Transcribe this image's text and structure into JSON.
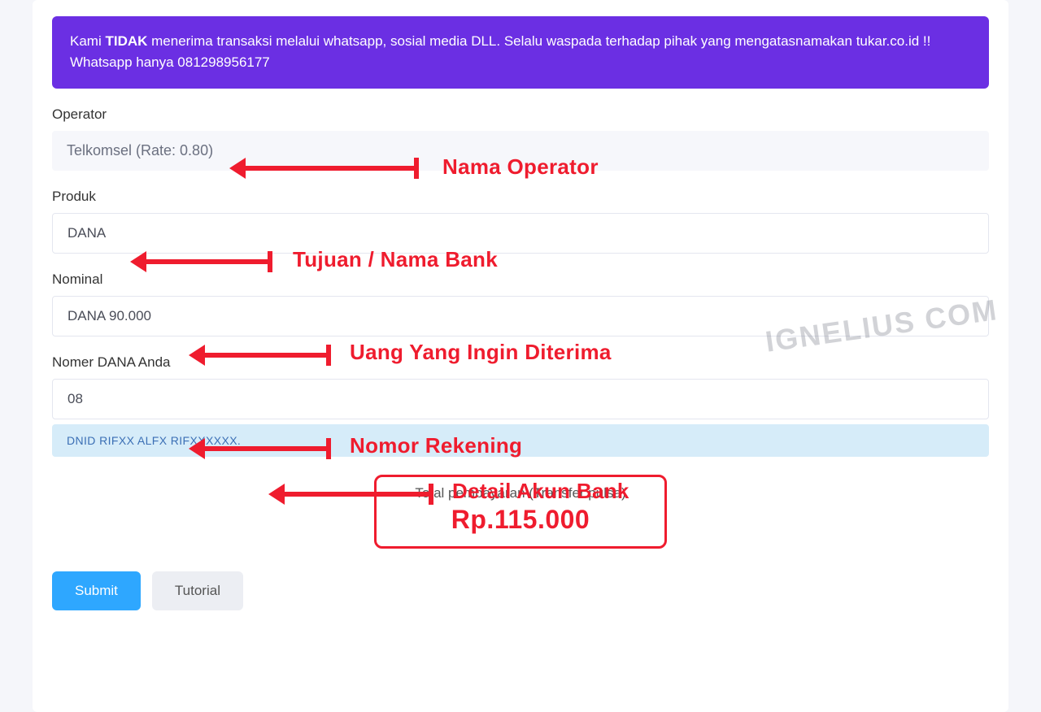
{
  "alert": {
    "pre": "Kami ",
    "bold": "TIDAK",
    "post": " menerima transaksi melalui whatsapp, sosial media DLL. Selalu waspada terhadap pihak yang mengatasnamakan tukar.co.id !! Whatsapp hanya 081298956177"
  },
  "labels": {
    "operator": "Operator",
    "produk": "Produk",
    "nominal": "Nominal",
    "nomer": "Nomer DANA Anda"
  },
  "values": {
    "operator": "Telkomsel (Rate: 0.80)",
    "produk": "DANA",
    "nominal": "DANA 90.000",
    "nomer": "08",
    "detail": "DNID RIFXX ALFX RIFXXXXXX."
  },
  "total": {
    "title": "Total pembayaran (Transfer pulsa)",
    "amount": "Rp.115.000"
  },
  "buttons": {
    "submit": "Submit",
    "tutorial": "Tutorial"
  },
  "annotations": {
    "operator": "Nama Operator",
    "produk": "Tujuan / Nama Bank",
    "nominal": "Uang Yang Ingin Diterima",
    "nomer": "Nomor Rekening",
    "detail": "Detail Akun Bank"
  },
  "watermark": "IGNELIUS COM"
}
